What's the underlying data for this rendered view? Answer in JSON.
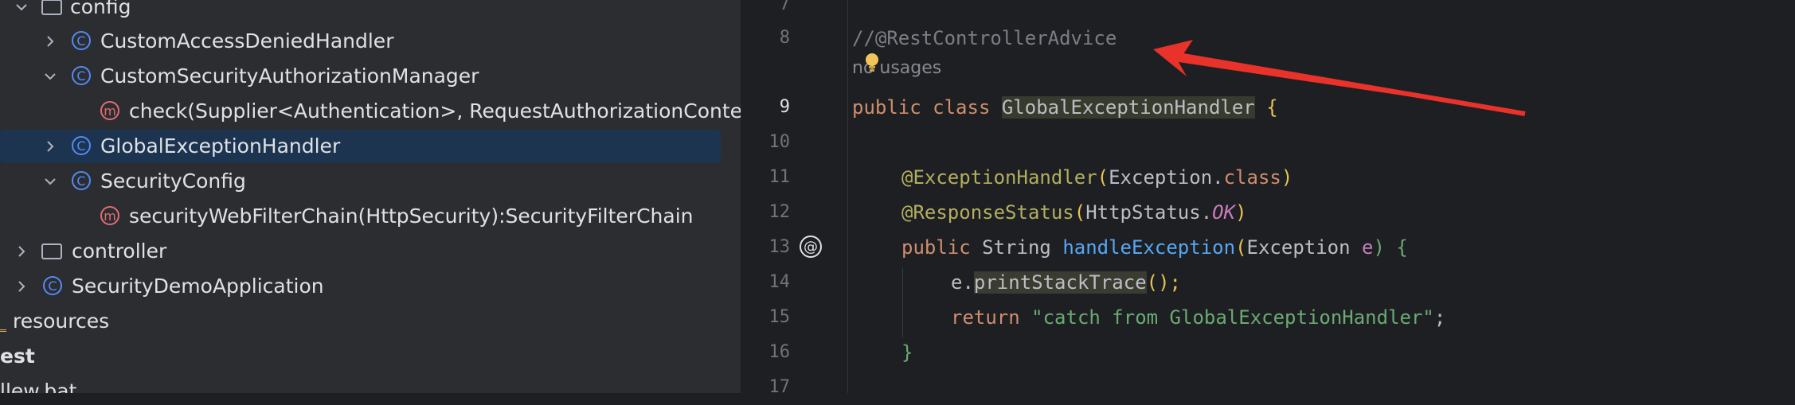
{
  "project_tree": {
    "config_folder": "config",
    "items": [
      {
        "label": "CustomAccessDeniedHandler",
        "icon": "class-icon"
      },
      {
        "label": "CustomSecurityAuthorizationManager",
        "icon": "class-icon"
      },
      {
        "label": "check(Supplier<Authentication>, RequestAuthorizationContext",
        "icon": "method-icon"
      },
      {
        "label": "GlobalExceptionHandler",
        "icon": "class-icon"
      },
      {
        "label": "SecurityConfig",
        "icon": "class-icon"
      },
      {
        "label": "securityWebFilterChain(HttpSecurity):SecurityFilterChain",
        "icon": "method-icon"
      },
      {
        "label": "controller",
        "icon": "folder-icon"
      },
      {
        "label": "SecurityDemoApplication",
        "icon": "spring-class-icon"
      },
      {
        "label": "resources",
        "icon": "resources-folder-icon"
      },
      {
        "label": "est",
        "icon": ""
      },
      {
        "label": "llew.bat",
        "icon": ""
      }
    ],
    "icon_letters": {
      "class": "C",
      "method": "m"
    }
  },
  "editor": {
    "line_numbers": [
      "7",
      "8",
      "9",
      "10",
      "11",
      "12",
      "13",
      "14",
      "15",
      "16",
      "17"
    ],
    "usages_hint": "no usages",
    "code": {
      "l8": "//@RestControllerAdvice",
      "l9_kw1": "public",
      "l9_kw2": "class",
      "l9_name": "GlobalExceptionHandler",
      "l9_brace": "{",
      "l11_ann": "@ExceptionHandler",
      "l11_open": "(",
      "l11_type": "Exception",
      "l11_dot": ".",
      "l11_class": "class",
      "l11_close": ")",
      "l12_ann": "@ResponseStatus",
      "l12_open": "(",
      "l12_type": "HttpStatus.",
      "l12_const": "OK",
      "l12_close": ")",
      "l13_kw": "public",
      "l13_type": "String",
      "l13_fn": "handleException",
      "l13_open": "(",
      "l13_ptype": "Exception",
      "l13_param": "e",
      "l13_close": ") {",
      "l14_obj": "e.",
      "l14_call": "printStackTrace",
      "l14_end": "();",
      "l15_kw": "return",
      "l15_str": "\"catch from GlobalExceptionHandler\"",
      "l15_end": ";",
      "l16": "}"
    },
    "gutter_marker": "@"
  },
  "colors": {
    "arrow": "#e8322a",
    "selection": "#1c3450"
  }
}
